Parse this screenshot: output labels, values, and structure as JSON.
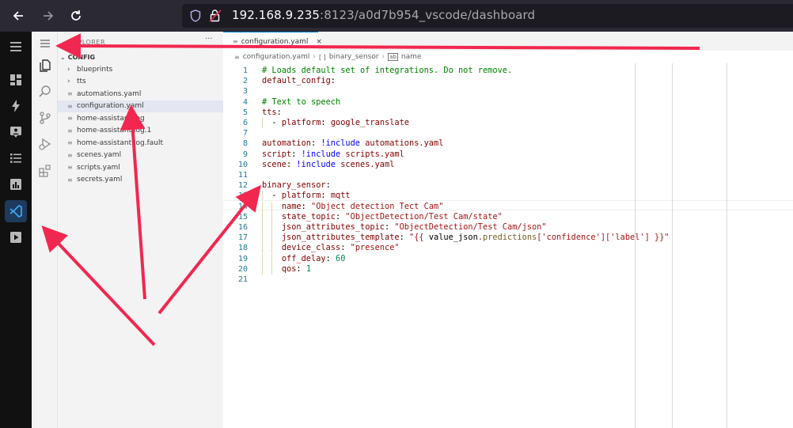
{
  "browser": {
    "url_host": "192.168.9.235",
    "url_rest": ":8123/a0d7b954_vscode/dashboard"
  },
  "ha_sidebar": {
    "items": [
      {
        "icon": "menu-icon"
      },
      {
        "icon": "dashboard-icon"
      },
      {
        "icon": "energy-icon"
      },
      {
        "icon": "map-icon"
      },
      {
        "icon": "logbook-icon"
      },
      {
        "icon": "history-icon"
      },
      {
        "icon": "vscode-icon"
      },
      {
        "icon": "media-icon"
      }
    ]
  },
  "activity_bar": {
    "items": [
      {
        "icon": "hamburger-icon"
      },
      {
        "icon": "explorer-icon"
      },
      {
        "icon": "search-icon"
      },
      {
        "icon": "source-control-icon"
      },
      {
        "icon": "run-debug-icon"
      },
      {
        "icon": "extensions-icon"
      }
    ]
  },
  "explorer": {
    "title": "EXPLORER",
    "more": "···",
    "folder": "CONFIG",
    "items": [
      {
        "label": "blueprints",
        "type": "folder"
      },
      {
        "label": "tts",
        "type": "folder"
      },
      {
        "label": "automations.yaml",
        "type": "file"
      },
      {
        "label": "configuration.yaml",
        "type": "file"
      },
      {
        "label": "home-assistant.log",
        "type": "file"
      },
      {
        "label": "home-assistant.log.1",
        "type": "file"
      },
      {
        "label": "home-assistant.log.fault",
        "type": "file"
      },
      {
        "label": "scenes.yaml",
        "type": "file"
      },
      {
        "label": "scripts.yaml",
        "type": "file"
      },
      {
        "label": "secrets.yaml",
        "type": "file"
      }
    ]
  },
  "tabs": [
    {
      "label": "configuration.yaml",
      "close": "×"
    }
  ],
  "breadcrumb": {
    "file": "configuration.yaml",
    "section": "binary_sensor",
    "field": "name"
  },
  "code": {
    "lines": [
      {
        "n": "1",
        "text": "# Loads default set of integrations. Do not remove."
      },
      {
        "n": "2",
        "text": "default_config:"
      },
      {
        "n": "3",
        "text": ""
      },
      {
        "n": "4",
        "text": "# Text to speech"
      },
      {
        "n": "5",
        "text": "tts:"
      },
      {
        "n": "6",
        "text": "  - platform: google_translate"
      },
      {
        "n": "7",
        "text": ""
      },
      {
        "n": "8",
        "text": "automation: !include automations.yaml"
      },
      {
        "n": "9",
        "text": "script: !include scripts.yaml"
      },
      {
        "n": "10",
        "text": "scene: !include scenes.yaml"
      },
      {
        "n": "11",
        "text": ""
      },
      {
        "n": "12",
        "text": "binary_sensor:"
      },
      {
        "n": "13",
        "text": "  - platform: mqtt"
      },
      {
        "n": "14",
        "text": "    name: \"Object detection Tect Cam\""
      },
      {
        "n": "15",
        "text": "    state_topic: \"ObjectDetection/Test Cam/state\""
      },
      {
        "n": "16",
        "text": "    json_attributes_topic: \"ObjectDetection/Test Cam/json\""
      },
      {
        "n": "17",
        "text": "    json_attributes_template: \"{{ value_json.predictions['confidence']['label'] }}\""
      },
      {
        "n": "18",
        "text": "    device_class: \"presence\""
      },
      {
        "n": "19",
        "text": "    off_delay: 60"
      },
      {
        "n": "20",
        "text": "    qos: 1"
      },
      {
        "n": "21",
        "text": ""
      }
    ]
  },
  "colors": {
    "annotation_arrow": "#f2274f",
    "accent": "#007acc"
  }
}
